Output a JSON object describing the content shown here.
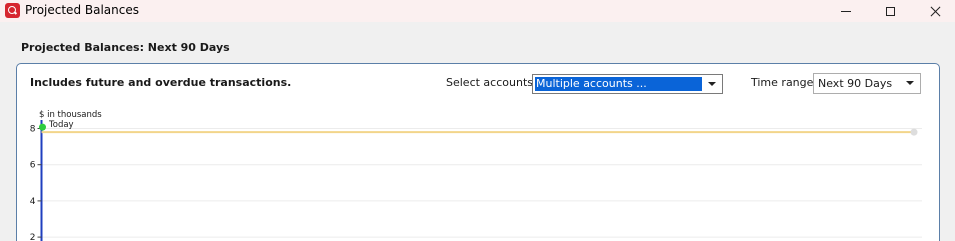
{
  "window": {
    "title": "Projected Balances"
  },
  "heading": "Projected Balances: Next 90 Days",
  "panel": {
    "note": "Includes future and overdue transactions.",
    "accounts_label": "Select accounts",
    "accounts_value": "Multiple accounts ...",
    "range_label": "Time range",
    "range_value": "Next 90 Days"
  },
  "colors": {
    "accent": "#0a64d8",
    "brand": "#d6262f",
    "today_marker": "#2ecc40",
    "balance_line": "#f2d58a",
    "axis_line": "#1f3fbf"
  },
  "icons": {
    "app": "quicken-icon",
    "minimize": "minimize-icon",
    "maximize": "maximize-icon",
    "close": "close-icon",
    "dropdown": "chevron-down-icon"
  },
  "chart_data": {
    "type": "line",
    "ylabel": "$ in thousands",
    "marker_label": "Today",
    "y_ticks": [
      2,
      4,
      6,
      8
    ],
    "y_visible_range": [
      2,
      8
    ],
    "grid": true,
    "series": [
      {
        "values": [
          7.8,
          7.8
        ]
      }
    ]
  }
}
